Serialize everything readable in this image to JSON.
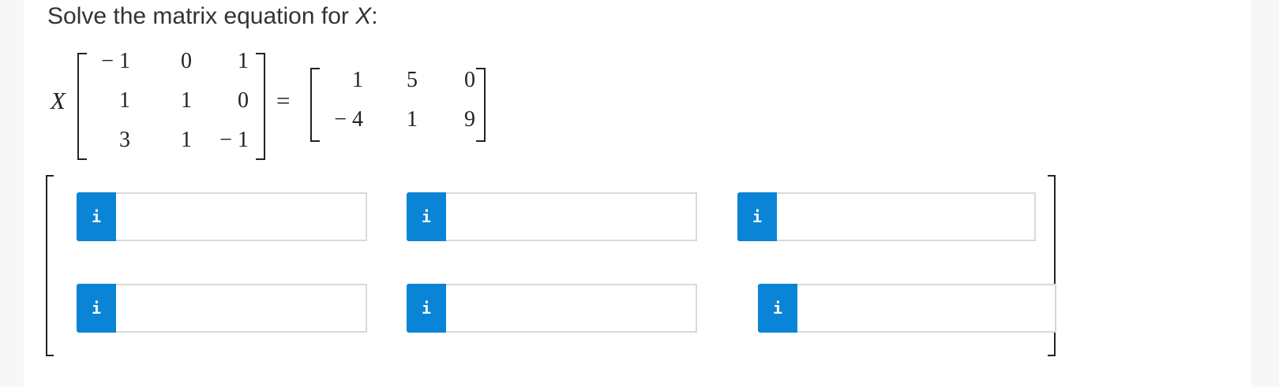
{
  "prompt": {
    "text_before": "Solve the matrix equation for ",
    "variable": "X",
    "text_after": ":"
  },
  "equation": {
    "unknown": "X",
    "equals": "=",
    "coefficient_matrix": [
      [
        "− 1",
        "0",
        "1"
      ],
      [
        "1",
        "1",
        "0"
      ],
      [
        "3",
        "1",
        "− 1"
      ]
    ],
    "result_matrix": [
      [
        "1",
        "5",
        "0"
      ],
      [
        "− 4",
        "1",
        "9"
      ]
    ]
  },
  "answer_matrix": {
    "rows": [
      [
        {
          "icon": "i",
          "value": ""
        },
        {
          "icon": "i",
          "value": ""
        },
        {
          "icon": "i",
          "value": ""
        }
      ],
      [
        {
          "icon": "i",
          "value": ""
        },
        {
          "icon": "i",
          "value": ""
        },
        {
          "icon": "i",
          "value": ""
        }
      ]
    ]
  },
  "colors": {
    "info_button": "#0a84d6",
    "input_border": "#d9d9d9",
    "text": "#333333"
  }
}
